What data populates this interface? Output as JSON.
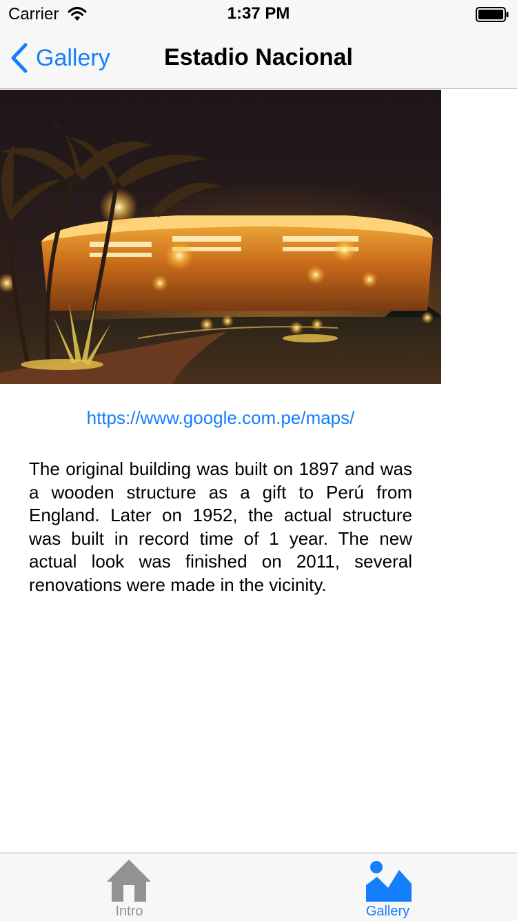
{
  "status_bar": {
    "carrier": "Carrier",
    "time": "1:37 PM",
    "icons": [
      "wifi-icon",
      "battery-icon"
    ]
  },
  "nav": {
    "back_label": "Gallery",
    "title": "Estadio Nacional",
    "back_icon": "chevron-left-icon"
  },
  "content": {
    "image": "stadium-night-photo",
    "link": "https://www.google.com.pe/maps/",
    "description": "The original building was built on 1897 and was a wooden structure as a gift to Perú from England. Later on 1952, the actual structure was built in record time of 1 year. The new actual look was finished on 2011, several renovations were made in the vicinity."
  },
  "tab_bar": {
    "items": [
      {
        "label": "Intro",
        "icon": "home-icon",
        "selected": false
      },
      {
        "label": "Gallery",
        "icon": "gallery-icon",
        "selected": true
      }
    ]
  },
  "colors": {
    "accent": "#157efb",
    "inactive": "#929292",
    "bar_background": "#f7f7f7"
  }
}
